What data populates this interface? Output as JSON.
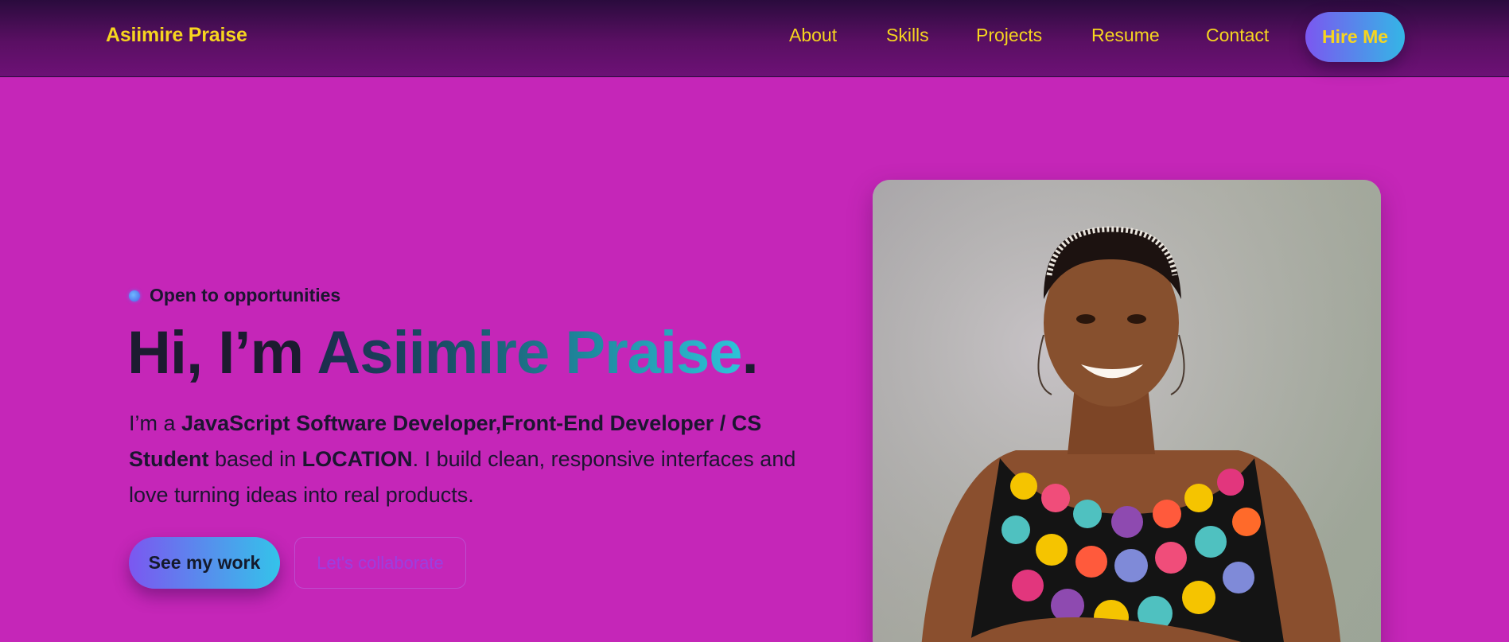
{
  "nav": {
    "brand": "Asiimire Praise",
    "links": [
      "About",
      "Skills",
      "Projects",
      "Resume",
      "Contact"
    ],
    "hire_label": "Hire Me"
  },
  "hero": {
    "badge": "Open to opportunities",
    "headline_prefix": "Hi, I’m ",
    "headline_name": "Asiimire Praise",
    "headline_suffix": ".",
    "bio_intro": "I’m a ",
    "bio_role": "JavaScript Software Developer,Front-End Developer / CS Student",
    "bio_mid": " based in ",
    "bio_location": "LOCATION",
    "bio_rest": ". I build clean, responsive interfaces and love turning ideas into real products.",
    "primary_cta": "See my work",
    "secondary_cta": "Let's collaborate"
  },
  "colors": {
    "background": "#c526b8",
    "accent_yellow": "#f6d51f",
    "gradient_start": "#7b57f0",
    "gradient_end": "#34b6e6"
  },
  "icons": {
    "status_dot": "status-dot-icon",
    "portrait": "portrait-photo"
  }
}
